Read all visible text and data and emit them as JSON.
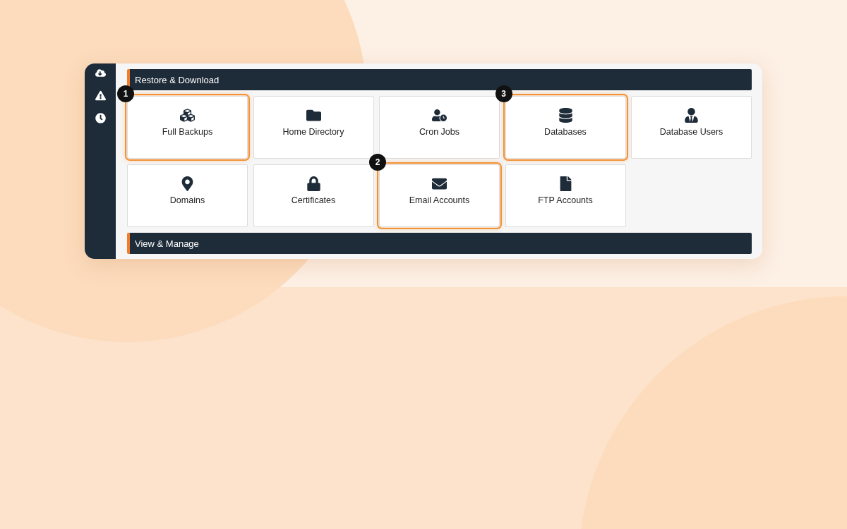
{
  "sidebar": {
    "items": [
      {
        "kind": "download"
      },
      {
        "kind": "warning"
      },
      {
        "kind": "clock"
      }
    ]
  },
  "sections": [
    {
      "title": "Restore & Download",
      "tiles": [
        {
          "label": "Full Backups",
          "kind": "cubes",
          "highlighted": true,
          "step": "1"
        },
        {
          "label": "Home Directory",
          "kind": "folder",
          "highlighted": false
        },
        {
          "label": "Cron Jobs",
          "kind": "cron",
          "highlighted": false
        },
        {
          "label": "Databases",
          "kind": "database",
          "highlighted": true,
          "step": "3"
        },
        {
          "label": "Database Users",
          "kind": "users",
          "highlighted": false
        },
        {
          "label": "Domains",
          "kind": "domain",
          "highlighted": false
        },
        {
          "label": "Certificates",
          "kind": "lock",
          "highlighted": false
        },
        {
          "label": "Email Accounts",
          "kind": "email",
          "highlighted": true,
          "step": "2"
        },
        {
          "label": "FTP Accounts",
          "kind": "file",
          "highlighted": false
        }
      ]
    },
    {
      "title": "View & Manage"
    }
  ]
}
